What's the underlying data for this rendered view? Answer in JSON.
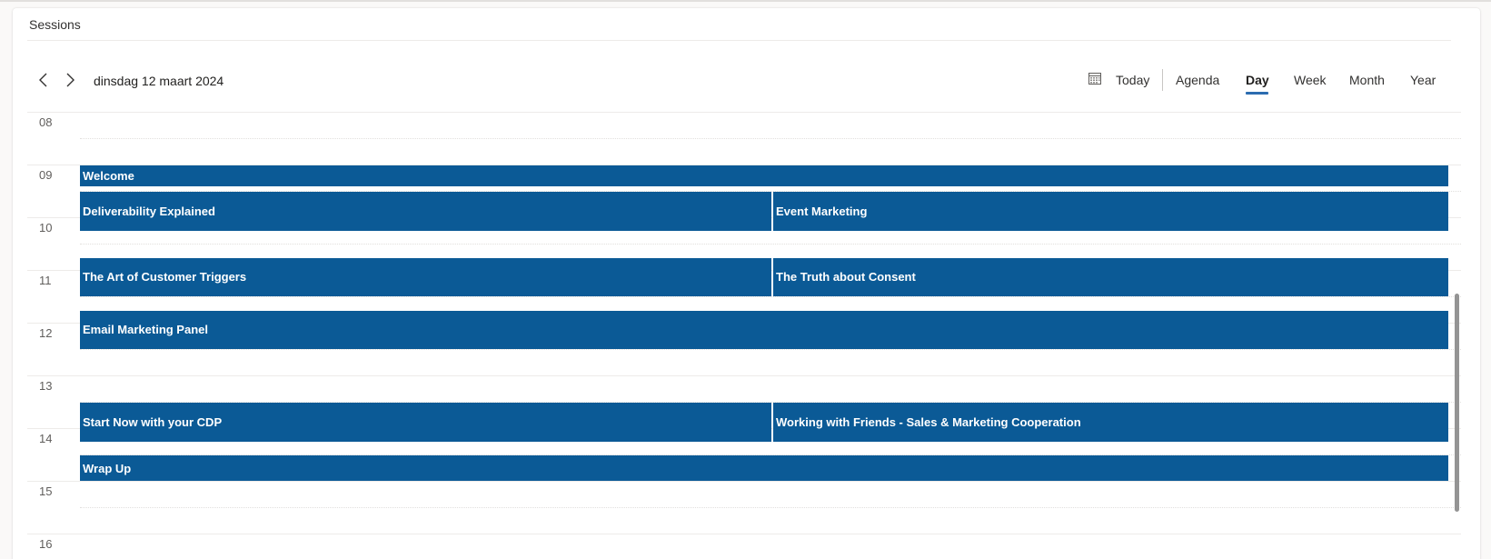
{
  "card": {
    "title": "Sessions"
  },
  "toolbar": {
    "current_date": "dinsdag 12 maart 2024",
    "prev_icon": "chevron-left-icon",
    "next_icon": "chevron-right-icon",
    "calendar_icon": "calendar-icon",
    "today_label": "Today",
    "views": [
      {
        "label": "Agenda",
        "active": false
      },
      {
        "label": "Day",
        "active": true
      },
      {
        "label": "Week",
        "active": false
      },
      {
        "label": "Month",
        "active": false
      },
      {
        "label": "Year",
        "active": false
      }
    ]
  },
  "timeline": {
    "hours": [
      "08",
      "09",
      "10",
      "11",
      "12",
      "13",
      "14",
      "15",
      "16"
    ],
    "events": [
      {
        "title": "Welcome",
        "start": "09:00",
        "end": "09:25",
        "column": "full"
      },
      {
        "title": "Deliverability Explained",
        "start": "09:30",
        "end": "10:15",
        "column": "left"
      },
      {
        "title": "Event Marketing",
        "start": "09:30",
        "end": "10:15",
        "column": "right"
      },
      {
        "title": "The Art of Customer Triggers",
        "start": "10:45",
        "end": "11:30",
        "column": "left"
      },
      {
        "title": "The Truth about Consent",
        "start": "10:45",
        "end": "11:30",
        "column": "right"
      },
      {
        "title": "Email Marketing Panel",
        "start": "11:45",
        "end": "12:30",
        "column": "full"
      },
      {
        "title": "Start Now with your CDP",
        "start": "13:30",
        "end": "14:15",
        "column": "left"
      },
      {
        "title": "Working with Friends - Sales & Marketing Cooperation",
        "start": "13:30",
        "end": "14:15",
        "column": "right"
      },
      {
        "title": "Wrap Up",
        "start": "14:30",
        "end": "15:00",
        "column": "full"
      }
    ]
  },
  "colors": {
    "event": "#0b5a96",
    "accent": "#2b6cb0"
  }
}
